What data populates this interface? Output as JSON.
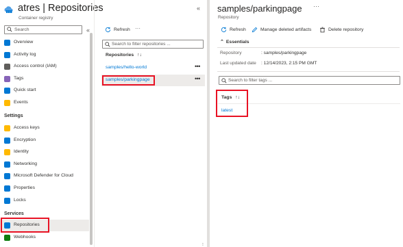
{
  "left_blade": {
    "title": "atres | Repositories",
    "subtitle": "Container registry",
    "search_placeholder": "Search",
    "collapse_glyph": "«",
    "close_glyph": "«",
    "nav_top": [
      {
        "label": "Overview",
        "icon": "overview-icon",
        "color": "#0078d4"
      },
      {
        "label": "Activity log",
        "icon": "activity-log-icon",
        "color": "#0078d4"
      },
      {
        "label": "Access control (IAM)",
        "icon": "iam-icon",
        "color": "#605e5c"
      },
      {
        "label": "Tags",
        "icon": "tag-icon",
        "color": "#8764b8"
      },
      {
        "label": "Quick start",
        "icon": "quick-start-icon",
        "color": "#0078d4"
      },
      {
        "label": "Events",
        "icon": "events-icon",
        "color": "#ffb900"
      }
    ],
    "settings_heading": "Settings",
    "nav_settings": [
      {
        "label": "Access keys",
        "icon": "key-icon",
        "color": "#ffb900"
      },
      {
        "label": "Encryption",
        "icon": "shield-icon",
        "color": "#0078d4"
      },
      {
        "label": "Identity",
        "icon": "identity-icon",
        "color": "#ffb900"
      },
      {
        "label": "Networking",
        "icon": "networking-icon",
        "color": "#0078d4"
      },
      {
        "label": "Microsoft Defender for Cloud",
        "icon": "defender-icon",
        "color": "#0078d4"
      },
      {
        "label": "Properties",
        "icon": "properties-icon",
        "color": "#0078d4"
      },
      {
        "label": "Locks",
        "icon": "lock-icon",
        "color": "#0078d4"
      }
    ],
    "services_heading": "Services",
    "nav_services": [
      {
        "label": "Repositories",
        "icon": "repositories-icon",
        "color": "#0078d4",
        "active": true
      },
      {
        "label": "Webhooks",
        "icon": "webhooks-icon",
        "color": "#107c10",
        "active": false
      }
    ]
  },
  "middle_blade": {
    "refresh_label": "Refresh",
    "more_glyph": "···",
    "search_placeholder": "Search to filter repositories ...",
    "column_header": "Repositories",
    "sort_glyph": "↑↓",
    "repositories": [
      {
        "name": "samples/hello-world",
        "selected": false
      },
      {
        "name": "samples/parkingpage",
        "selected": true
      }
    ],
    "row_more_glyph": "•••"
  },
  "right_blade": {
    "title": "samples/parkingpage",
    "subtitle": "Repository",
    "more_glyph": "···",
    "toolbar": {
      "refresh_label": "Refresh",
      "manage_label": "Manage deleted artifacts",
      "delete_label": "Delete repository"
    },
    "essentials_heading": "Essentials",
    "essentials": [
      {
        "label": "Repository",
        "value": ": samples/parkingpage"
      },
      {
        "label": "Last updated date",
        "value": ": 12/14/2023, 2:15 PM GMT"
      }
    ],
    "search_placeholder": "Search to filter tags ...",
    "tags_header": "Tags",
    "sort_glyph": "↑↓",
    "tags": [
      "latest"
    ]
  },
  "colors": {
    "accent": "#0078d4",
    "highlight": "#e81123",
    "selected_row": "#edebe9"
  }
}
